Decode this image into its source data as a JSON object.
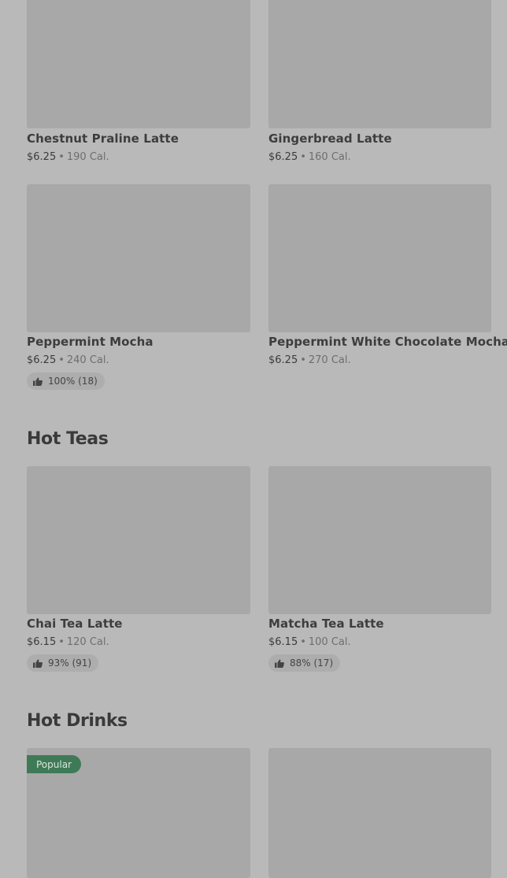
{
  "rows": {
    "row1": {
      "left": {
        "name": "Chestnut Praline Latte",
        "price": "$6.25",
        "calories": "190 Cal."
      },
      "right": {
        "name": "Gingerbread Latte",
        "price": "$6.25",
        "calories": "160 Cal."
      }
    },
    "row2": {
      "left": {
        "name": "Peppermint Mocha",
        "price": "$6.25",
        "calories": "240 Cal.",
        "rating": "100% (18)"
      },
      "right": {
        "name": "Peppermint White Chocolate Mocha",
        "price": "$6.25",
        "calories": "270 Cal."
      }
    }
  },
  "sections": {
    "hot_teas": {
      "title": "Hot Teas",
      "left": {
        "name": "Chai Tea Latte",
        "price": "$6.15",
        "calories": "120 Cal.",
        "rating": "93% (91)"
      },
      "right": {
        "name": "Matcha Tea Latte",
        "price": "$6.15",
        "calories": "100 Cal.",
        "rating": "88% (17)"
      }
    },
    "hot_drinks": {
      "title": "Hot Drinks",
      "badge": "Popular"
    }
  },
  "separator": "•",
  "colors": {
    "background": "#b9b9b9",
    "thumbnail": "#a8a8a8",
    "popular_badge": "#3f7a57"
  }
}
